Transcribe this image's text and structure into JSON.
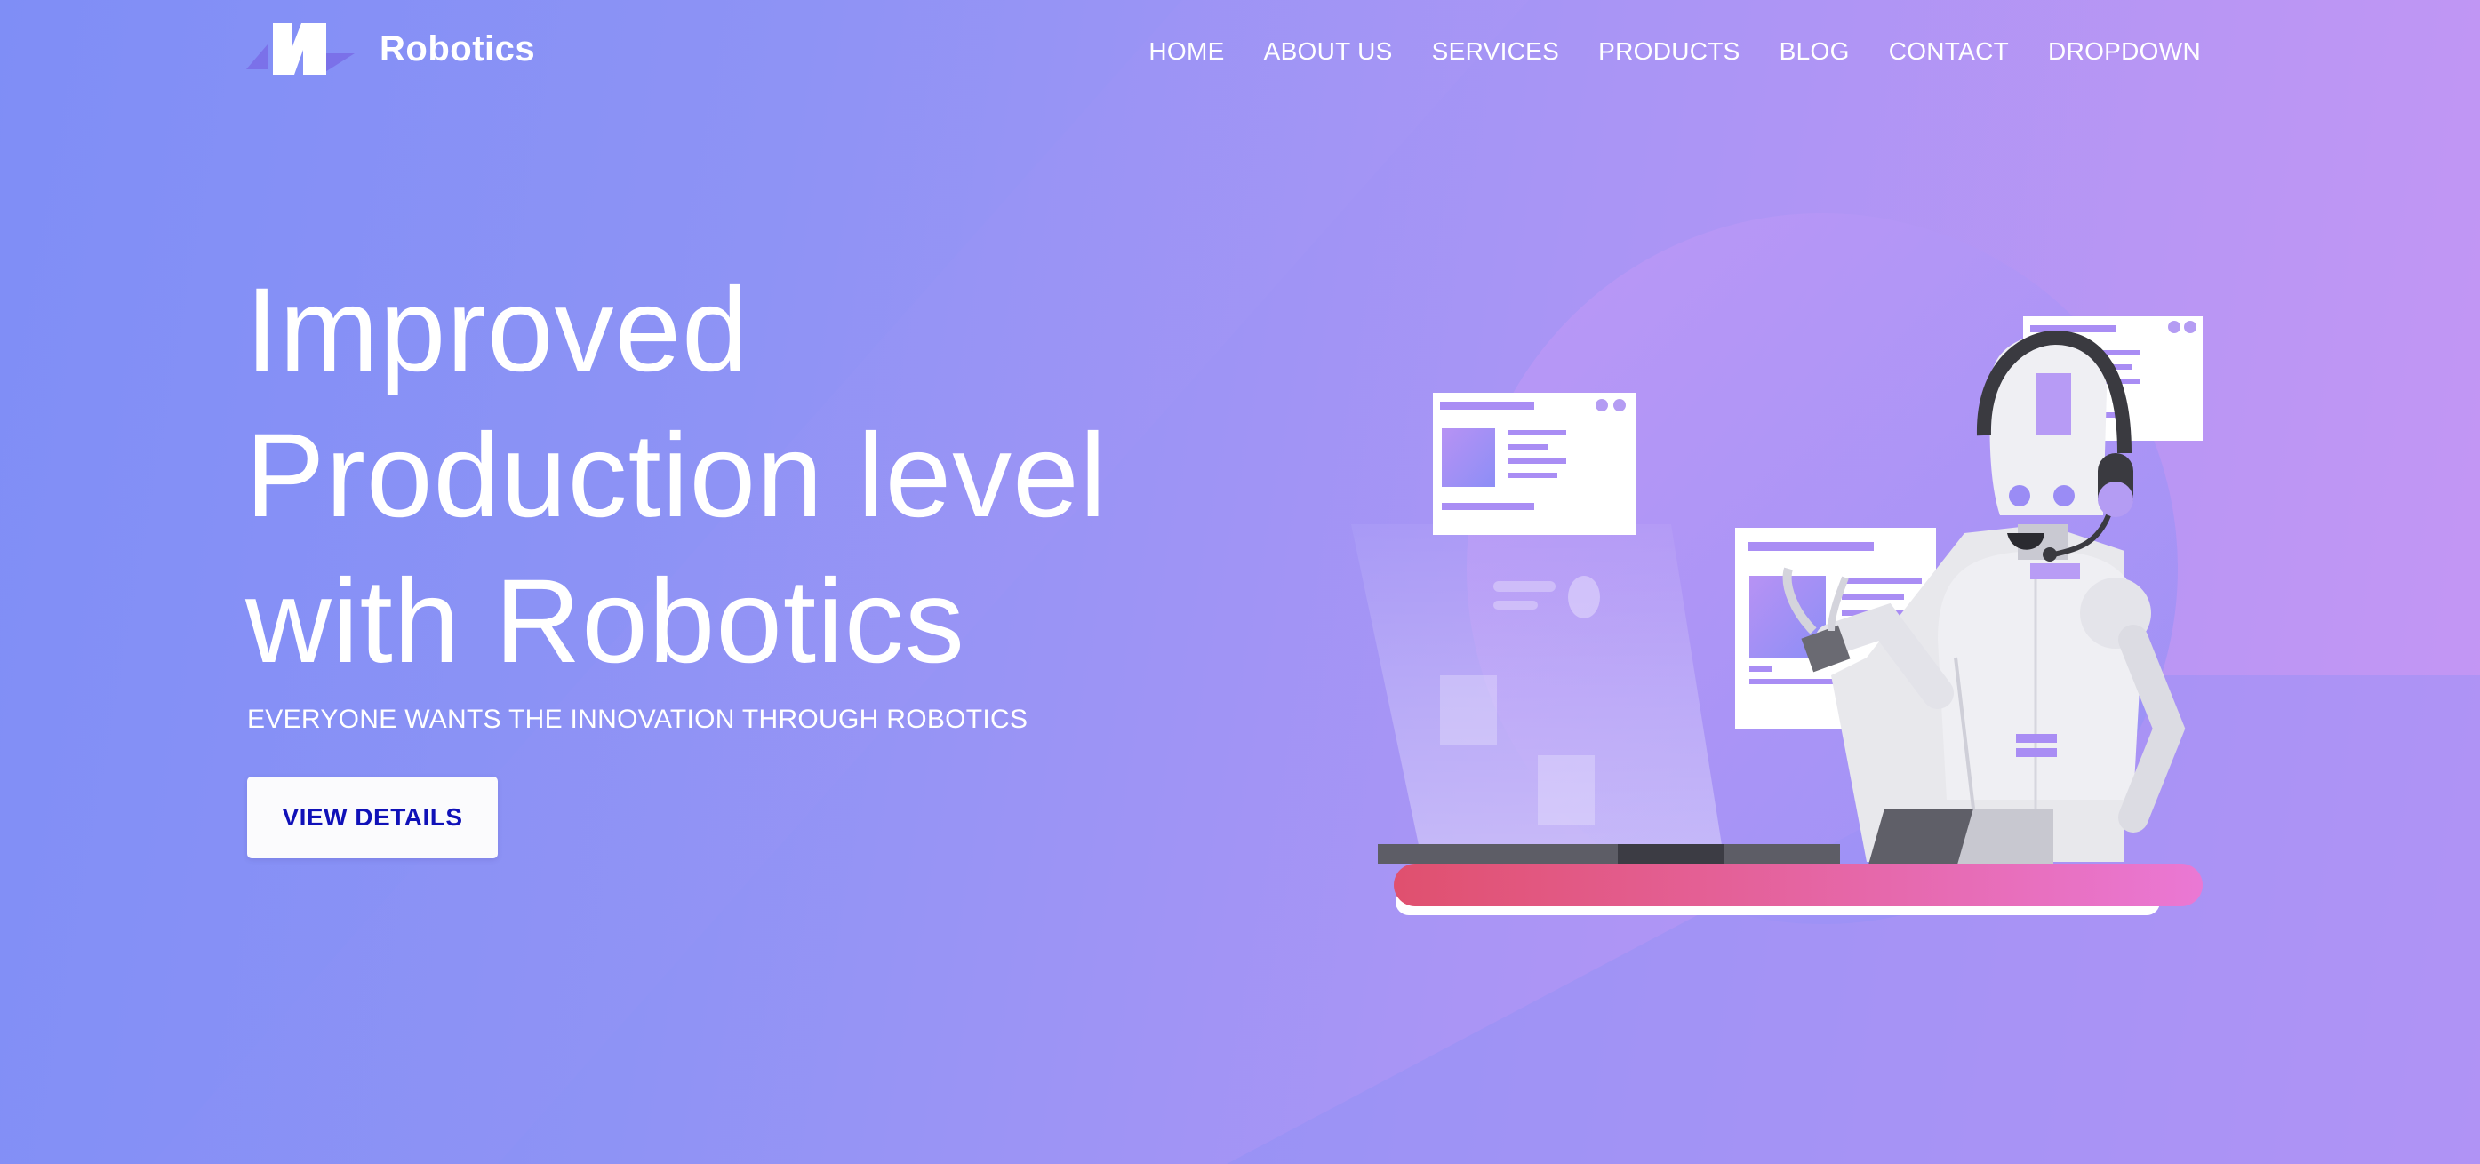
{
  "brand": {
    "name": "Robotics",
    "logo_icon": "logo-icon"
  },
  "nav": {
    "items": [
      {
        "label": "HOME"
      },
      {
        "label": "ABOUT US"
      },
      {
        "label": "SERVICES"
      },
      {
        "label": "PRODUCTS"
      },
      {
        "label": "BLOG"
      },
      {
        "label": "CONTACT"
      },
      {
        "label": "DROPDOWN"
      }
    ]
  },
  "hero": {
    "title_lines": [
      "Improved",
      "Production level",
      "with Robotics"
    ],
    "subtitle": "EVERYONE WANTS THE INNOVATION THROUGH ROBOTICS",
    "cta_label": "VIEW DETAILS"
  },
  "colors": {
    "bg_start": "#7f8ef6",
    "bg_end": "#c596f4",
    "cta_text": "#1011b8",
    "desk_stripe_start": "#e0506e",
    "desk_stripe_end": "#ea78d4"
  },
  "illustration": {
    "icon": "robot-assistant-illustration"
  }
}
